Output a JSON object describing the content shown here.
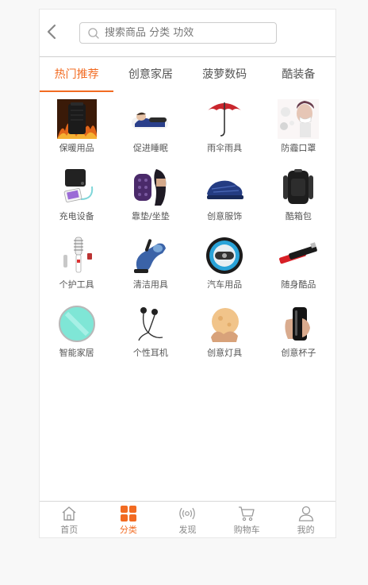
{
  "header": {
    "back_icon": "chevron-left-icon",
    "search_placeholder": "搜索商品 分类 功效",
    "search_icon": "search-icon"
  },
  "tabs": [
    {
      "label": "热门推荐",
      "active": true
    },
    {
      "label": "创意家居",
      "active": false
    },
    {
      "label": "菠萝数码",
      "active": false
    },
    {
      "label": "酷装备",
      "active": false
    }
  ],
  "categories": [
    {
      "label": "保暖用品",
      "icon": "heater-image"
    },
    {
      "label": "促进睡眠",
      "icon": "pillow-image"
    },
    {
      "label": "雨伞雨具",
      "icon": "umbrella-image"
    },
    {
      "label": "防霾口罩",
      "icon": "mask-image"
    },
    {
      "label": "充电设备",
      "icon": "charger-image"
    },
    {
      "label": "靠垫/坐垫",
      "icon": "cushion-image"
    },
    {
      "label": "创意服饰",
      "icon": "shoe-image"
    },
    {
      "label": "酷箱包",
      "icon": "backpack-image"
    },
    {
      "label": "个护工具",
      "icon": "hair-brush-image"
    },
    {
      "label": "清洁用具",
      "icon": "vacuum-image"
    },
    {
      "label": "汽车用品",
      "icon": "car-gadget-image"
    },
    {
      "label": "随身酷品",
      "icon": "lighter-image"
    },
    {
      "label": "智能家居",
      "icon": "smart-device-image"
    },
    {
      "label": "个性耳机",
      "icon": "earphones-image"
    },
    {
      "label": "创意灯具",
      "icon": "moon-lamp-image"
    },
    {
      "label": "创意杯子",
      "icon": "cup-image"
    }
  ],
  "tabbar": [
    {
      "label": "首页",
      "icon": "home-icon",
      "active": false
    },
    {
      "label": "分类",
      "icon": "category-grid-icon",
      "active": true
    },
    {
      "label": "发现",
      "icon": "broadcast-icon",
      "active": false
    },
    {
      "label": "购物车",
      "icon": "cart-icon",
      "active": false
    },
    {
      "label": "我的",
      "icon": "user-icon",
      "active": false
    }
  ],
  "colors": {
    "accent": "#f26b22",
    "text": "#555555",
    "muted": "#888888"
  }
}
